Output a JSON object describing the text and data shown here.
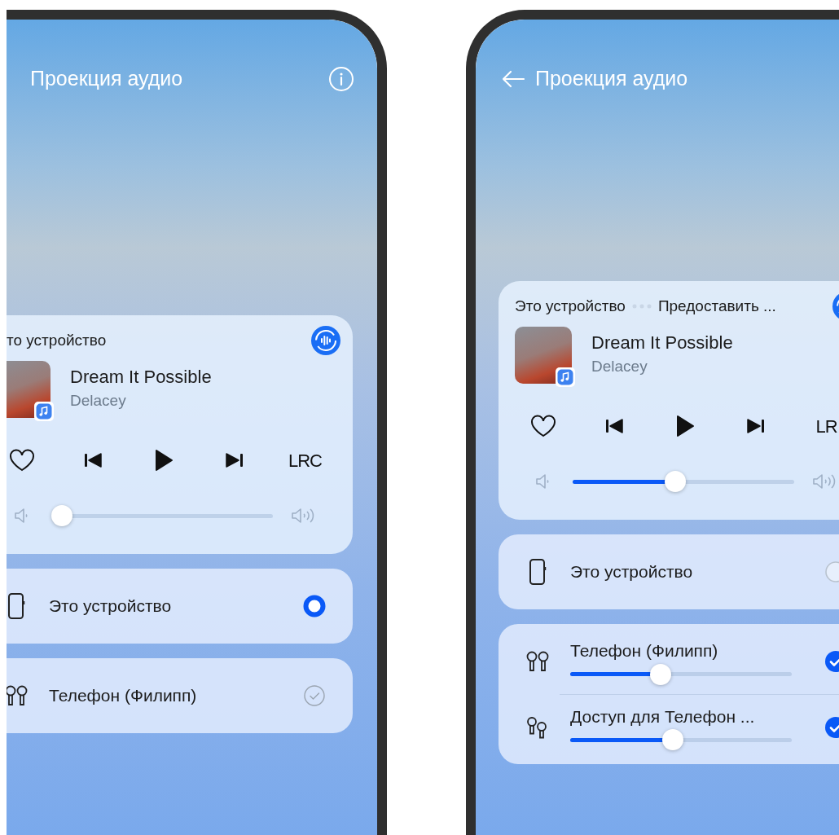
{
  "screens": [
    {
      "kind": "main",
      "title": "Проекция аудио",
      "player": {
        "route": [
          "то устройство"
        ],
        "track_title": "Dream It Possible",
        "artist": "Delacey",
        "lyrics_label": "LRC",
        "volume": {
          "level": 0
        }
      },
      "device_groups": [
        {
          "items": [
            {
              "name": "Это устройство",
              "kind": "phone",
              "selected": true
            }
          ]
        },
        {
          "items": [
            {
              "name": "Телефон (Филипп)",
              "kind": "earbuds",
              "checked": false
            }
          ]
        }
      ]
    },
    {
      "kind": "sub",
      "title": "Проекция аудио",
      "player": {
        "route": [
          "Это устройство",
          "Предоставить ..."
        ],
        "track_title": "Dream It Possible",
        "artist": "Delacey",
        "lyrics_label": "LR",
        "volume": {
          "level": 0.46
        }
      },
      "device_groups": [
        {
          "items": [
            {
              "name": "Это устройство",
              "kind": "phone",
              "selected": false
            }
          ]
        },
        {
          "items": [
            {
              "name": "Телефон (Филипп)",
              "kind": "earbuds",
              "checked": true,
              "level": 0.4
            },
            {
              "name": "Доступ для Телефон ...",
              "kind": "earbuds-pair",
              "checked": true,
              "level": 0.46
            }
          ]
        }
      ]
    }
  ]
}
